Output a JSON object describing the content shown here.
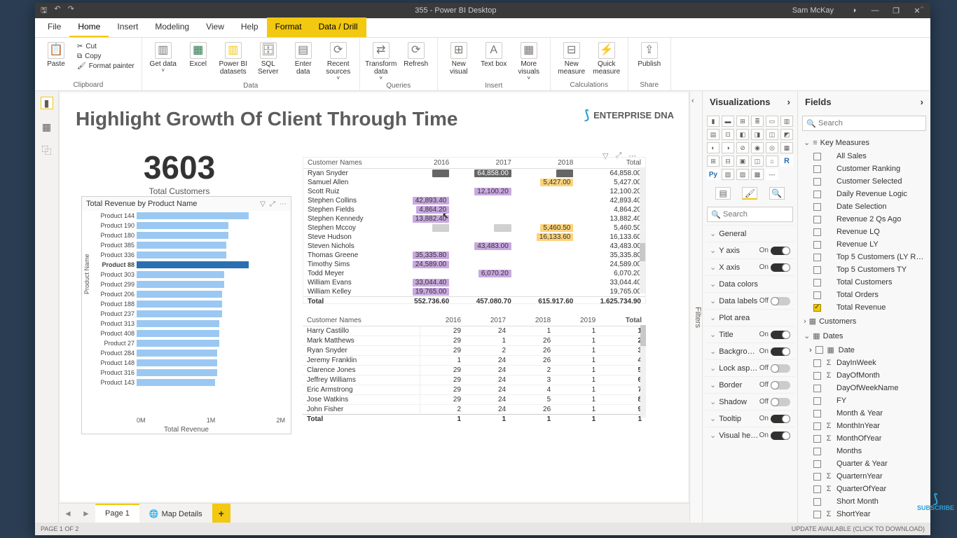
{
  "titlebar": {
    "title": "355 - Power BI Desktop",
    "user": "Sam McKay"
  },
  "ribbonTabs": [
    "File",
    "Home",
    "Insert",
    "Modeling",
    "View",
    "Help",
    "Format",
    "Data / Drill"
  ],
  "ribbon": {
    "clipboard": {
      "paste": "Paste",
      "cut": "Cut",
      "copy": "Copy",
      "fmt": "Format painter",
      "label": "Clipboard"
    },
    "data": {
      "get": "Get data",
      "excel": "Excel",
      "pbi": "Power BI datasets",
      "sql": "SQL Server",
      "enter": "Enter data",
      "recent": "Recent sources",
      "label": "Data"
    },
    "queries": {
      "transform": "Transform data",
      "refresh": "Refresh",
      "label": "Queries"
    },
    "insert": {
      "newvis": "New visual",
      "textbox": "Text box",
      "more": "More visuals",
      "label": "Insert"
    },
    "calc": {
      "newmeasure": "New measure",
      "quick": "Quick measure",
      "label": "Calculations"
    },
    "share": {
      "publish": "Publish",
      "label": "Share"
    }
  },
  "report": {
    "title": "Highlight Growth Of Client Through Time",
    "logo": "ENTERPRISE DNA",
    "card": {
      "value": "3603",
      "label": "Total Customers"
    },
    "bar": {
      "title": "Total Revenue by Product Name",
      "ylabel": "Product Name",
      "xlabel": "Total Revenue",
      "xticks": [
        "0M",
        "1M",
        "2M"
      ],
      "selected": "Product 88",
      "rows": [
        {
          "p": "Product 144",
          "v": 100
        },
        {
          "p": "Product 190",
          "v": 82
        },
        {
          "p": "Product 180",
          "v": 82
        },
        {
          "p": "Product 385",
          "v": 80
        },
        {
          "p": "Product 336",
          "v": 80
        },
        {
          "p": "Product 88",
          "v": 100
        },
        {
          "p": "Product 303",
          "v": 78
        },
        {
          "p": "Product 299",
          "v": 78
        },
        {
          "p": "Product 206",
          "v": 76
        },
        {
          "p": "Product 188",
          "v": 76
        },
        {
          "p": "Product 237",
          "v": 76
        },
        {
          "p": "Product 313",
          "v": 74
        },
        {
          "p": "Product 408",
          "v": 74
        },
        {
          "p": "Product 27",
          "v": 74
        },
        {
          "p": "Product 284",
          "v": 72
        },
        {
          "p": "Product 148",
          "v": 72
        },
        {
          "p": "Product 316",
          "v": 72
        },
        {
          "p": "Product 143",
          "v": 70
        }
      ]
    },
    "matrix1": {
      "headers": [
        "Customer Names",
        "2016",
        "2017",
        "2018",
        "Total"
      ],
      "rows": [
        {
          "n": "Ryan Snyder",
          "c": [
            [
              "",
              "b"
            ],
            [
              "64,858.00",
              "b"
            ],
            [
              "",
              "b"
            ]
          ],
          "t": "64,858.00"
        },
        {
          "n": "Samuel Allen",
          "c": [
            [
              "",
              ""
            ],
            [
              "",
              ""
            ],
            [
              "5,427.00",
              "y"
            ]
          ],
          "t": "5,427.00"
        },
        {
          "n": "Scott Ruiz",
          "c": [
            [
              "",
              ""
            ],
            [
              "12,100.20",
              "p"
            ],
            [
              "",
              ""
            ]
          ],
          "t": "12,100.20"
        },
        {
          "n": "Stephen Collins",
          "c": [
            [
              "42,893.40",
              "p"
            ],
            [
              "",
              ""
            ],
            [
              "",
              ""
            ]
          ],
          "t": "42,893.40"
        },
        {
          "n": "Stephen Fields",
          "c": [
            [
              "4,864.20",
              "p"
            ],
            [
              "",
              ""
            ],
            [
              "",
              ""
            ]
          ],
          "t": "4,864.20"
        },
        {
          "n": "Stephen Kennedy",
          "c": [
            [
              "13,882.40",
              "p"
            ],
            [
              "",
              ""
            ],
            [
              "",
              ""
            ]
          ],
          "t": "13,882.40"
        },
        {
          "n": "Stephen Mccoy",
          "c": [
            [
              "",
              "g"
            ],
            [
              "",
              "g"
            ],
            [
              "5,460.50",
              "y"
            ]
          ],
          "t": "5,460.50"
        },
        {
          "n": "Steve Hudson",
          "c": [
            [
              "",
              ""
            ],
            [
              "",
              ""
            ],
            [
              "16,133.60",
              "y"
            ]
          ],
          "t": "16,133.60"
        },
        {
          "n": "Steven Nichols",
          "c": [
            [
              "",
              ""
            ],
            [
              "43,483.00",
              "p"
            ],
            [
              "",
              ""
            ]
          ],
          "t": "43,483.00"
        },
        {
          "n": "Thomas Greene",
          "c": [
            [
              "35,335.80",
              "p"
            ],
            [
              "",
              ""
            ],
            [
              "",
              ""
            ]
          ],
          "t": "35,335.80"
        },
        {
          "n": "Timothy Sims",
          "c": [
            [
              "24,589.00",
              "p"
            ],
            [
              "",
              ""
            ],
            [
              "",
              ""
            ]
          ],
          "t": "24,589.00"
        },
        {
          "n": "Todd Meyer",
          "c": [
            [
              "",
              ""
            ],
            [
              "6,070.20",
              "p"
            ],
            [
              "",
              ""
            ]
          ],
          "t": "6,070.20"
        },
        {
          "n": "William Evans",
          "c": [
            [
              "33,044.40",
              "p"
            ],
            [
              "",
              ""
            ],
            [
              "",
              ""
            ]
          ],
          "t": "33,044.40"
        },
        {
          "n": "William Kelley",
          "c": [
            [
              "19,765.00",
              "p"
            ],
            [
              "",
              ""
            ],
            [
              "",
              ""
            ]
          ],
          "t": "19,765.00"
        }
      ],
      "footer": [
        "Total",
        "552,736.60",
        "457,080.70",
        "615,917.60",
        "1,625,734.90"
      ]
    },
    "matrix2": {
      "headers": [
        "Customer Names",
        "2016",
        "2017",
        "2018",
        "2019",
        "Total"
      ],
      "rows": [
        {
          "n": "Harry Castillo",
          "c": [
            "29",
            "24",
            "1",
            "1"
          ],
          "t": "1"
        },
        {
          "n": "Mark Matthews",
          "c": [
            "29",
            "1",
            "26",
            "1"
          ],
          "t": "2"
        },
        {
          "n": "Ryan Snyder",
          "c": [
            "29",
            "2",
            "26",
            "1"
          ],
          "t": "3"
        },
        {
          "n": "Jeremy Franklin",
          "c": [
            "1",
            "24",
            "26",
            "1"
          ],
          "t": "4"
        },
        {
          "n": "Clarence Jones",
          "c": [
            "29",
            "24",
            "2",
            "1"
          ],
          "t": "5"
        },
        {
          "n": "Jeffrey Williams",
          "c": [
            "29",
            "24",
            "3",
            "1"
          ],
          "t": "6"
        },
        {
          "n": "Eric Armstrong",
          "c": [
            "29",
            "24",
            "4",
            "1"
          ],
          "t": "7"
        },
        {
          "n": "Jose Watkins",
          "c": [
            "29",
            "24",
            "5",
            "1"
          ],
          "t": "8"
        },
        {
          "n": "John Fisher",
          "c": [
            "2",
            "24",
            "26",
            "1"
          ],
          "t": "9"
        }
      ],
      "footer": [
        "Total",
        "1",
        "1",
        "1",
        "1",
        "1"
      ]
    }
  },
  "viz": {
    "header": "Visualizations",
    "search": "Search",
    "format": [
      {
        "l": "General",
        "t": null
      },
      {
        "l": "Y axis",
        "t": "On"
      },
      {
        "l": "X axis",
        "t": "On"
      },
      {
        "l": "Data colors",
        "t": null
      },
      {
        "l": "Data labels",
        "t": "Off"
      },
      {
        "l": "Plot area",
        "t": null
      },
      {
        "l": "Title",
        "t": "On"
      },
      {
        "l": "Backgrou…",
        "t": "On"
      },
      {
        "l": "Lock aspe…",
        "t": "Off"
      },
      {
        "l": "Border",
        "t": "Off"
      },
      {
        "l": "Shadow",
        "t": "Off"
      },
      {
        "l": "Tooltip",
        "t": "On"
      },
      {
        "l": "Visual he…",
        "t": "On"
      }
    ]
  },
  "fields": {
    "header": "Fields",
    "search": "Search",
    "tables": [
      {
        "name": "Key Measures",
        "exp": true,
        "ic": "≡",
        "items": [
          {
            "n": "All Sales",
            "ic": "",
            "ck": false
          },
          {
            "n": "Customer Ranking",
            "ic": "",
            "ck": false
          },
          {
            "n": "Customer Selected",
            "ic": "",
            "ck": false
          },
          {
            "n": "Daily Revenue Logic",
            "ic": "",
            "ck": false
          },
          {
            "n": "Date Selection",
            "ic": "",
            "ck": false
          },
          {
            "n": "Revenue 2 Qs Ago",
            "ic": "",
            "ck": false
          },
          {
            "n": "Revenue LQ",
            "ic": "",
            "ck": false
          },
          {
            "n": "Revenue LY",
            "ic": "",
            "ck": false
          },
          {
            "n": "Top 5 Customers (LY Rev)",
            "ic": "",
            "ck": false
          },
          {
            "n": "Top 5 Customers TY",
            "ic": "",
            "ck": false
          },
          {
            "n": "Total Customers",
            "ic": "",
            "ck": false
          },
          {
            "n": "Total Orders",
            "ic": "",
            "ck": false
          },
          {
            "n": "Total Revenue",
            "ic": "",
            "ck": true
          }
        ]
      },
      {
        "name": "Customers",
        "exp": false,
        "ic": "▦",
        "items": []
      },
      {
        "name": "Dates",
        "exp": true,
        "ic": "▦",
        "items": [
          {
            "n": "Date",
            "ic": "▦",
            "ck": false,
            "sub": true
          },
          {
            "n": "DayInWeek",
            "ic": "Σ",
            "ck": false
          },
          {
            "n": "DayOfMonth",
            "ic": "Σ",
            "ck": false
          },
          {
            "n": "DayOfWeekName",
            "ic": "",
            "ck": false
          },
          {
            "n": "FY",
            "ic": "",
            "ck": false
          },
          {
            "n": "Month & Year",
            "ic": "",
            "ck": false
          },
          {
            "n": "MonthInYear",
            "ic": "Σ",
            "ck": false
          },
          {
            "n": "MonthOfYear",
            "ic": "Σ",
            "ck": false
          },
          {
            "n": "Months",
            "ic": "",
            "ck": false
          },
          {
            "n": "Quarter & Year",
            "ic": "",
            "ck": false
          },
          {
            "n": "QuarternYear",
            "ic": "Σ",
            "ck": false
          },
          {
            "n": "QuarterOfYear",
            "ic": "Σ",
            "ck": false
          },
          {
            "n": "Short Month",
            "ic": "",
            "ck": false
          },
          {
            "n": "ShortYear",
            "ic": "Σ",
            "ck": false
          }
        ]
      }
    ]
  },
  "pages": {
    "p1": "Page 1",
    "p2": "Map Details",
    "status": "PAGE 1 OF 2",
    "update": "UPDATE AVAILABLE (CLICK TO DOWNLOAD)"
  },
  "filters": "Filters",
  "subscribe": "SUBSCRIBE"
}
